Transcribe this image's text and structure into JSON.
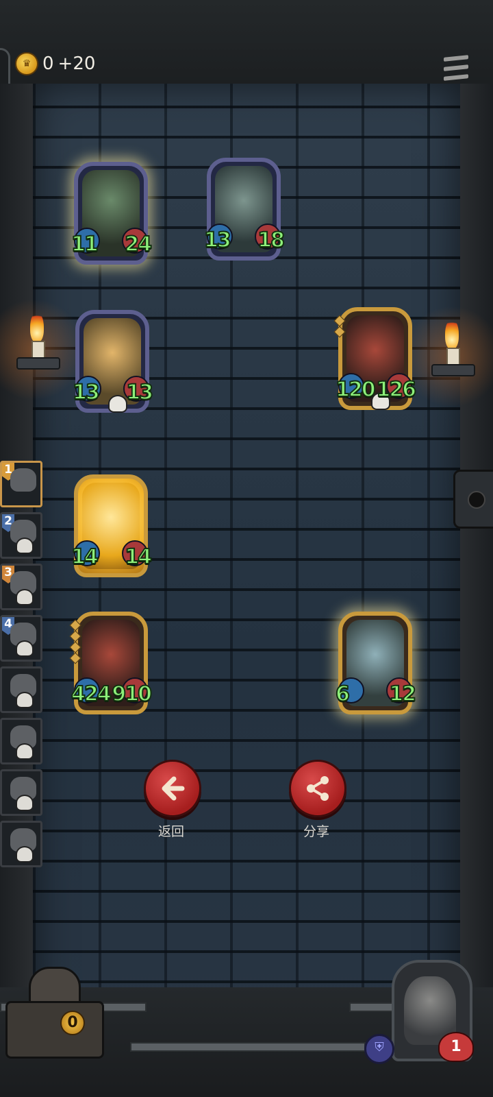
{
  "header": {
    "gold_value": "0",
    "gold_bonus": "+20",
    "coin_icon": "crown-coin-icon",
    "menu_icon": "hamburger-menu-icon"
  },
  "board": {
    "cards": [
      {
        "name": "horned-elf-card",
        "attack": "11",
        "health": "24",
        "frame": "silver",
        "selected": true
      },
      {
        "name": "fish-brute-card",
        "attack": "13",
        "health": "18",
        "frame": "silver",
        "selected": false
      },
      {
        "name": "puppet-boy-card",
        "attack": "13",
        "health": "13",
        "frame": "silver",
        "selected": false
      },
      {
        "name": "red-dragon-card-1",
        "attack": "120",
        "health": "126",
        "frame": "gold",
        "selected": false
      },
      {
        "name": "golden-figure-card",
        "attack": "14",
        "health": "14",
        "frame": "gold",
        "selected": false
      },
      {
        "name": "red-dragon-card-2",
        "attack": "424",
        "health": "910",
        "frame": "gold",
        "selected": false
      },
      {
        "name": "furry-beast-card",
        "attack": "6",
        "health": "12",
        "frame": "gold",
        "selected": true
      }
    ]
  },
  "actions": {
    "back_label": "返回",
    "share_label": "分享"
  },
  "ranking": {
    "slots": [
      {
        "rank": "1"
      },
      {
        "rank": "2"
      },
      {
        "rank": "3"
      },
      {
        "rank": "4"
      },
      {
        "rank": ""
      },
      {
        "rank": ""
      },
      {
        "rank": ""
      },
      {
        "rank": ""
      }
    ]
  },
  "bottom": {
    "shop_coins": "0",
    "hero_health": "1"
  }
}
